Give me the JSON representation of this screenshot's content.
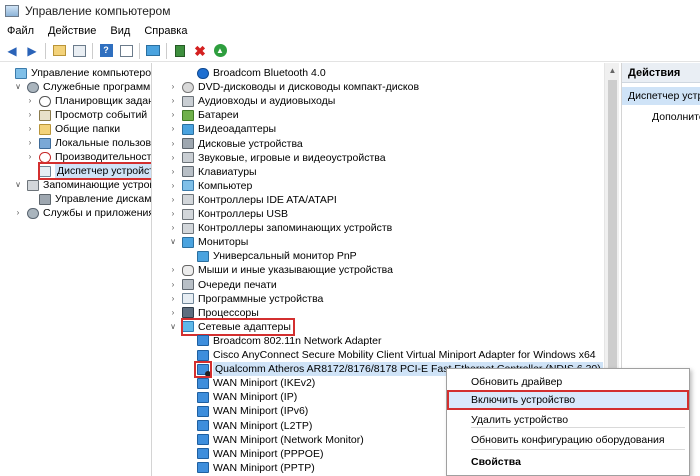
{
  "window": {
    "title": "Управление компьютером"
  },
  "menu": [
    "Файл",
    "Действие",
    "Вид",
    "Справка"
  ],
  "toolbar": {
    "buttons": [
      "back-arrow-icon",
      "forward-arrow-icon",
      "up-folder-icon",
      "properties-icon",
      "help-icon",
      "show-pane-icon",
      "monitor-icon",
      "update-driver-icon",
      "uninstall-icon",
      "enable-device-icon"
    ]
  },
  "left_tree": [
    {
      "label": "Управление компьютером (л",
      "level": 0,
      "exp": "",
      "icon": "ic-pc"
    },
    {
      "label": "Служебные программы",
      "level": 1,
      "exp": "∨",
      "icon": "ic-gear"
    },
    {
      "label": "Планировщик заданий",
      "level": 2,
      "exp": "›",
      "icon": "ic-clock"
    },
    {
      "label": "Просмотр событий",
      "level": 2,
      "exp": "›",
      "icon": "ic-ev"
    },
    {
      "label": "Общие папки",
      "level": 2,
      "exp": "›",
      "icon": "ic-fold"
    },
    {
      "label": "Локальные пользовате",
      "level": 2,
      "exp": "›",
      "icon": "ic-users"
    },
    {
      "label": "Производительность",
      "level": 2,
      "exp": "›",
      "icon": "ic-perf"
    },
    {
      "label": "Диспетчер устройств",
      "level": 2,
      "exp": "",
      "icon": "ic-dev",
      "selected": true
    },
    {
      "label": "Запоминающие устройст",
      "level": 1,
      "exp": "∨",
      "icon": "ic-disk"
    },
    {
      "label": "Управление дисками",
      "level": 2,
      "exp": "",
      "icon": "ic-hdd"
    },
    {
      "label": "Службы и приложения",
      "level": 1,
      "exp": "›",
      "icon": "ic-gear"
    }
  ],
  "device_tree": [
    {
      "label": "Broadcom Bluetooth 4.0",
      "level": 1,
      "exp": "",
      "icon": "ic-bt"
    },
    {
      "label": "DVD-дисководы и дисководы компакт-дисков",
      "level": 0,
      "exp": "›",
      "icon": "ic-dvd"
    },
    {
      "label": "Аудиовходы и аудиовыходы",
      "level": 0,
      "exp": "›",
      "icon": "ic-snd"
    },
    {
      "label": "Батареи",
      "level": 0,
      "exp": "›",
      "icon": "ic-bat"
    },
    {
      "label": "Видеоадаптеры",
      "level": 0,
      "exp": "›",
      "icon": "ic-mon"
    },
    {
      "label": "Дисковые устройства",
      "level": 0,
      "exp": "›",
      "icon": "ic-hdd"
    },
    {
      "label": "Звуковые, игровые и видеоустройства",
      "level": 0,
      "exp": "›",
      "icon": "ic-snd"
    },
    {
      "label": "Клавиатуры",
      "level": 0,
      "exp": "›",
      "icon": "ic-kb"
    },
    {
      "label": "Компьютер",
      "level": 0,
      "exp": "›",
      "icon": "ic-pc"
    },
    {
      "label": "Контроллеры IDE ATA/ATAPI",
      "level": 0,
      "exp": "›",
      "icon": "ic-disk"
    },
    {
      "label": "Контроллеры USB",
      "level": 0,
      "exp": "›",
      "icon": "ic-disk"
    },
    {
      "label": "Контроллеры запоминающих устройств",
      "level": 0,
      "exp": "›",
      "icon": "ic-disk"
    },
    {
      "label": "Мониторы",
      "level": 0,
      "exp": "∨",
      "icon": "ic-mon"
    },
    {
      "label": "Универсальный монитор PnP",
      "level": 1,
      "exp": "",
      "icon": "ic-mon"
    },
    {
      "label": "Мыши и иные указывающие устройства",
      "level": 0,
      "exp": "›",
      "icon": "ic-mouse"
    },
    {
      "label": "Очереди печати",
      "level": 0,
      "exp": "›",
      "icon": "ic-kb"
    },
    {
      "label": "Программные устройства",
      "level": 0,
      "exp": "›",
      "icon": "ic-dev"
    },
    {
      "label": "Процессоры",
      "level": 0,
      "exp": "›",
      "icon": "ic-cpu"
    },
    {
      "label": "Сетевые адаптеры",
      "level": 0,
      "exp": "∨",
      "icon": "ic-net",
      "boxed": true
    },
    {
      "label": "Broadcom 802.11n Network Adapter",
      "level": 1,
      "exp": "",
      "icon": "ic-adapt"
    },
    {
      "label": "Cisco AnyConnect Secure Mobility Client Virtual Miniport Adapter for Windows x64",
      "level": 1,
      "exp": "",
      "icon": "ic-adapt"
    },
    {
      "label": "Qualcomm Atheros AR8172/8176/8178 PCI-E Fast Ethernet Controller (NDIS 6.30)",
      "level": 1,
      "exp": "",
      "icon": "ic-adapt-dis",
      "selected": true
    },
    {
      "label": "WAN Miniport (IKEv2)",
      "level": 1,
      "exp": "",
      "icon": "ic-adapt"
    },
    {
      "label": "WAN Miniport (IP)",
      "level": 1,
      "exp": "",
      "icon": "ic-adapt"
    },
    {
      "label": "WAN Miniport (IPv6)",
      "level": 1,
      "exp": "",
      "icon": "ic-adapt"
    },
    {
      "label": "WAN Miniport (L2TP)",
      "level": 1,
      "exp": "",
      "icon": "ic-adapt"
    },
    {
      "label": "WAN Miniport (Network Monitor)",
      "level": 1,
      "exp": "",
      "icon": "ic-adapt"
    },
    {
      "label": "WAN Miniport (PPPOE)",
      "level": 1,
      "exp": "",
      "icon": "ic-adapt"
    },
    {
      "label": "WAN Miniport (PPTP)",
      "level": 1,
      "exp": "",
      "icon": "ic-adapt"
    }
  ],
  "actions": {
    "header": "Действия",
    "selected": "Диспетчер устро",
    "more": "Дополнител"
  },
  "context_menu": {
    "items": [
      {
        "label": "Обновить драйвер",
        "bold": false
      },
      {
        "label": "Включить устройство",
        "bold": false,
        "highlighted": true
      },
      {
        "label": "Удалить устройство",
        "bold": false
      },
      {
        "label": "Обновить конфигурацию оборудования",
        "bold": false
      },
      {
        "label": "Свойства",
        "bold": true
      }
    ]
  },
  "colors": {
    "highlight_border": "#d32f2f",
    "selection": "#cfe3f7",
    "accent": "#2c7cb5"
  }
}
